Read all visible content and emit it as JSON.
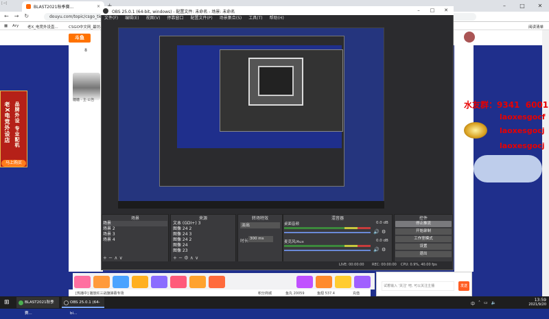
{
  "browser": {
    "tab_title": "BLAST2021秋季赛...",
    "url": "douyu.com/topic/csgo_tieba?rid=...",
    "bookmarks": [
      "Ary",
      "老X_电竞外设直...",
      "CSGO中文网_最坊..."
    ],
    "right_bookmark": "阅读清单",
    "top_left_note": "[→]"
  },
  "douyu": {
    "logo": "斗鱼",
    "follow_count": "8",
    "cat_label": "糖糖 · 主·公告",
    "left_banner_col1": "老X电竞外设店",
    "left_banner_col2": "品牌外设 专业配机",
    "left_banner_btn": "马上购买",
    "chat_placeholder": "试着输入 '关注' 吧, 可以关注主播",
    "send_label": "发送",
    "bottom_bar": [
      "[热播中] 播放红三战旗弹幕专场",
      "积分商城",
      "鱼丸 20059",
      "鱼翅 537.4",
      "充值"
    ]
  },
  "overlay": {
    "qq_line": "水友群：9341  6001",
    "name1": "laoxesgocf",
    "name2": "laoxesgocj",
    "name3": "laoxesgocj"
  },
  "obs": {
    "title": "OBS 25.0.1 (64-bit, windows) - 配置文件: 未命名 - 场景: 未命名",
    "menu": [
      "文件(F)",
      "编辑(E)",
      "视图(V)",
      "停靠窗口",
      "配置文件(P)",
      "场景集合(S)",
      "工具(T)",
      "帮助(H)"
    ],
    "docks": {
      "scenes_title": "场景",
      "sources_title": "来源",
      "filters_title": "转场特效",
      "mixer_title": "混音器",
      "controls_title": "控件"
    },
    "scenes": [
      "场景",
      "场景 2",
      "场景 3",
      "场景 4"
    ],
    "sources": [
      "文本 (GDI+) 3",
      "图像 24 2",
      "图像 24 3",
      "图像 24 2",
      "图像 24",
      "图像 23"
    ],
    "transition": "淡出",
    "duration_label": "时长",
    "duration_value": "300 ms",
    "mixer": [
      {
        "name": "桌面音频",
        "db": "0.0 dB"
      },
      {
        "name": "麦克风/Aux",
        "db": "0.0 dB"
      }
    ],
    "controls": [
      "停止推流",
      "开始录制",
      "工作室模式",
      "设置",
      "退出"
    ],
    "status": [
      "LIVE: 00:00:00",
      "REC: 00:00:00",
      "CPU: 0.9%, 40.00 fps"
    ]
  },
  "taskbar": {
    "app1": "BLAST2021秋季赛...",
    "app2": "OBS 25.0.1 (64-bi...",
    "time": "13:59",
    "date": "2021/9/20",
    "ime": "中"
  },
  "colors": {
    "page_bg": "#1f2f8c",
    "obs_bg": "#2b2b2e",
    "overlay_red": "#e80000",
    "douyu_orange": "#ff7200"
  }
}
